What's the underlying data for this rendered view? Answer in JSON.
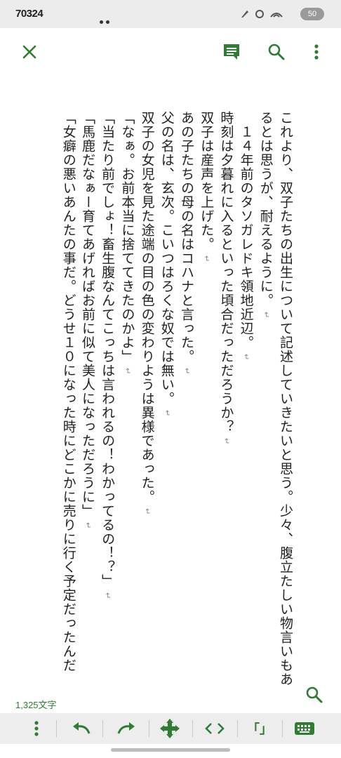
{
  "status_bar": {
    "time": "70324",
    "battery": "50"
  },
  "toolbar": {
    "close_icon": "close-icon",
    "comment_icon": "comment-icon",
    "search_icon": "search-icon",
    "menu_icon": "more-vert-icon"
  },
  "document": {
    "paragraphs": [
      {
        "text": "これより、双子たちの出生について記述していきたいと思う。少々、腹立たしい物言いもあるとは思うが、耐えるように。",
        "indent": false
      },
      {
        "text": "１４年前のタソガレドキ領地近辺。",
        "indent": true
      },
      {
        "text": "時刻は夕暮れに入るといった頃合だっただろうか？",
        "indent": false
      },
      {
        "text": "双子は産声を上げた。",
        "indent": false
      },
      {
        "text": "あの子たちの母の名はコハナと言った。",
        "indent": false
      },
      {
        "text": "父の名は、玄次。こいつはろくな奴では無い。",
        "indent": false
      },
      {
        "text": "双子の女児を見た途端の目の色の変わりようは異様であった。",
        "indent": false
      },
      {
        "text": "「なぁ。お前本当に捨ててきたのかよ」",
        "indent": false
      },
      {
        "text": "「当たり前でしょ！畜生腹なんてこっちは言われるの！わかってるの！？」",
        "indent": false
      },
      {
        "text": "「馬鹿だなぁー育てあげればお前に似て美人になっただろうに」",
        "indent": false
      },
      {
        "text": "「女癖の悪いあんたの事だ。どうせ１０になった時にどこかに売りに行く予定だったんだ",
        "indent": false
      }
    ],
    "return_mark": "↵"
  },
  "footer": {
    "char_count": "1,325文字",
    "bracket_label": "「」",
    "accent_color": "#2e7d32"
  }
}
